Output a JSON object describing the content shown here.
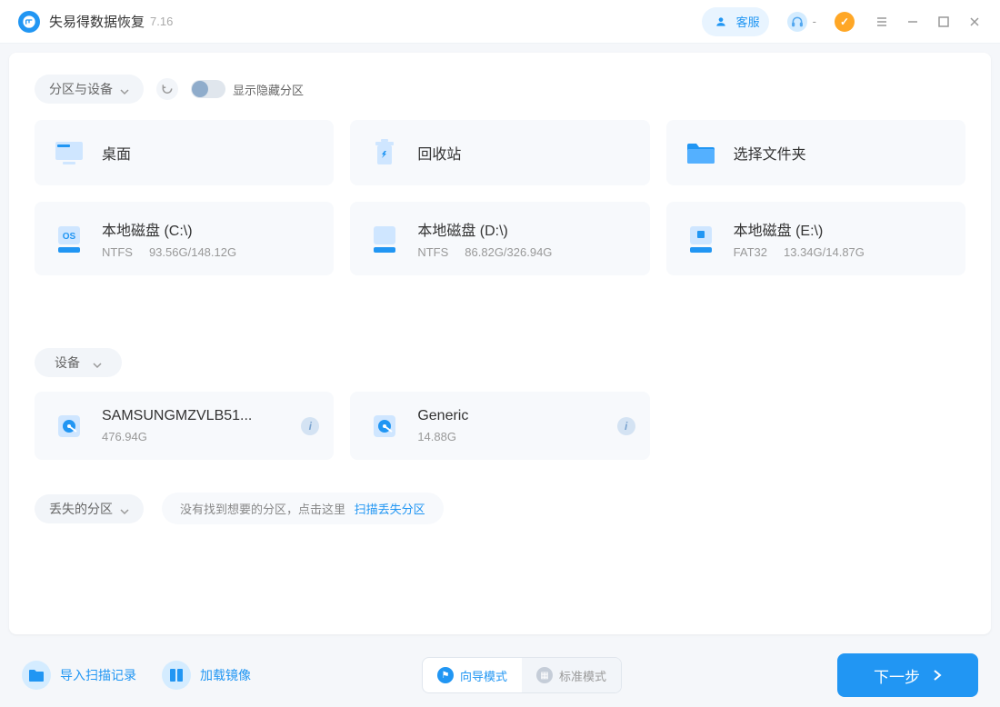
{
  "titlebar": {
    "app_name": "失易得数据恢复",
    "version": "7.16",
    "customer_service": "客服",
    "headphone_label": "-"
  },
  "sections": {
    "partition_label": "分区与设备",
    "hidden_toggle_label": "显示隐藏分区",
    "device_label": "设备",
    "lost_label": "丢失的分区",
    "lost_hint_text": "没有找到想要的分区，点击这里",
    "lost_hint_link": "扫描丢失分区"
  },
  "quick": [
    {
      "title": "桌面",
      "icon": "desktop"
    },
    {
      "title": "回收站",
      "icon": "recycle"
    },
    {
      "title": "选择文件夹",
      "icon": "folder"
    }
  ],
  "disks": [
    {
      "title": "本地磁盘 (C:\\)",
      "fs": "NTFS",
      "size": "93.56G/148.12G",
      "icon": "os"
    },
    {
      "title": "本地磁盘 (D:\\)",
      "fs": "NTFS",
      "size": "86.82G/326.94G",
      "icon": "disk"
    },
    {
      "title": "本地磁盘 (E:\\)",
      "fs": "FAT32",
      "size": "13.34G/14.87G",
      "icon": "ext"
    }
  ],
  "devices": [
    {
      "title": "SAMSUNGMZVLB51...",
      "size": "476.94G"
    },
    {
      "title": "Generic",
      "size": "14.88G"
    }
  ],
  "bottom": {
    "import_label": "导入扫描记录",
    "load_image_label": "加载镜像",
    "mode_wizard": "向导模式",
    "mode_standard": "标准模式",
    "next_label": "下一步"
  }
}
